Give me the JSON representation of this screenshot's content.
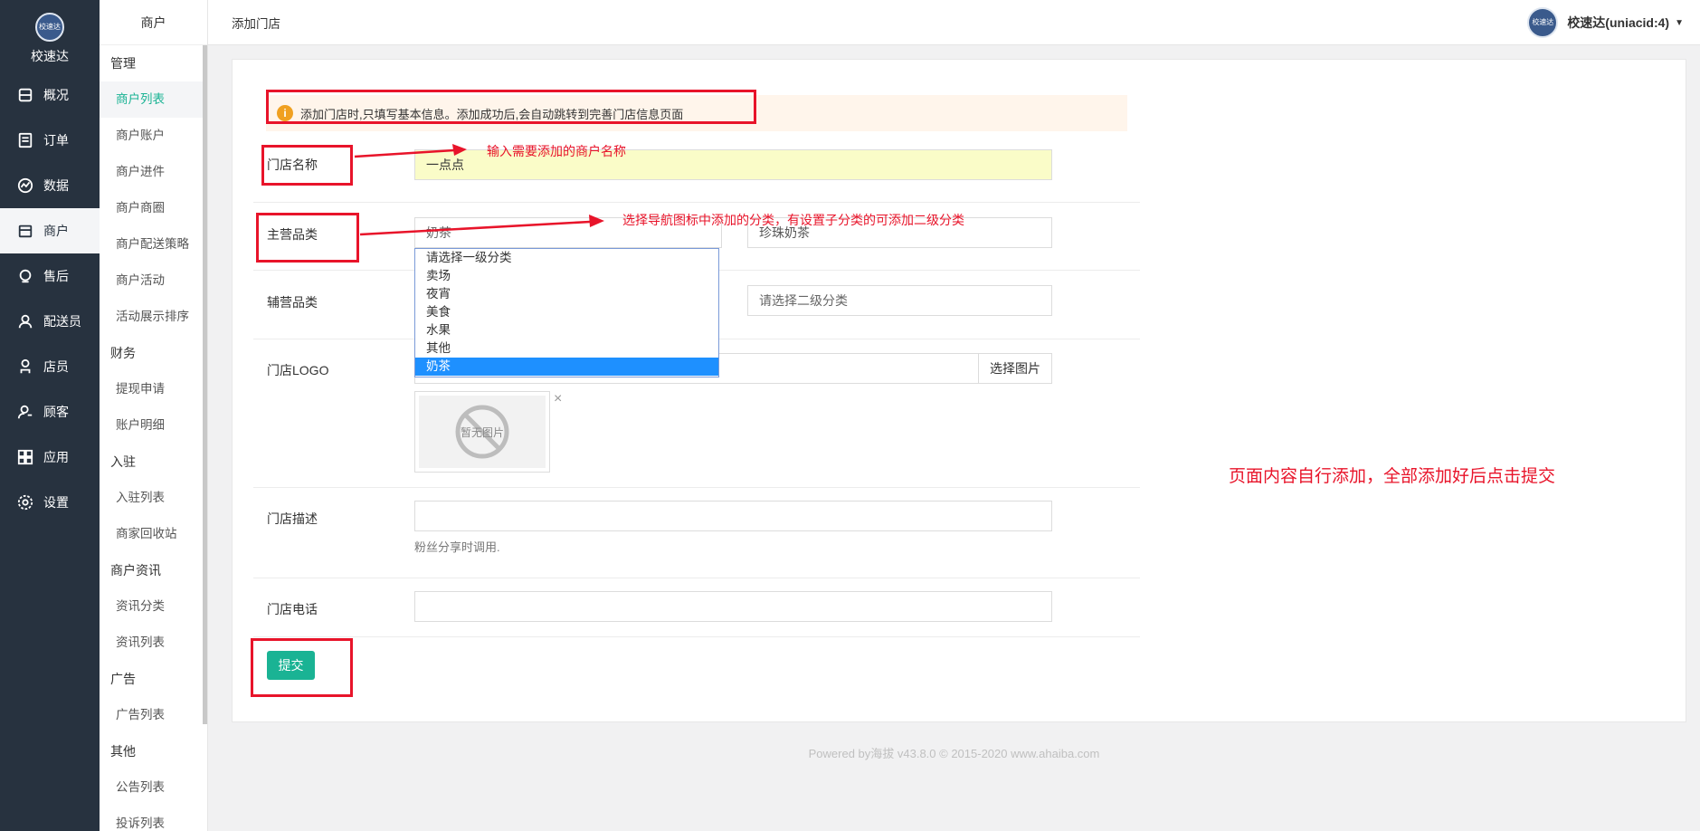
{
  "brand": {
    "logo_text": "校速达",
    "name": "校速达"
  },
  "nav": [
    {
      "label": "概况",
      "icon": "overview-icon"
    },
    {
      "label": "订单",
      "icon": "order-icon"
    },
    {
      "label": "数据",
      "icon": "data-icon"
    },
    {
      "label": "商户",
      "icon": "merchant-icon",
      "active": true
    },
    {
      "label": "售后",
      "icon": "aftersale-icon"
    },
    {
      "label": "配送员",
      "icon": "courier-icon"
    },
    {
      "label": "店员",
      "icon": "staff-icon"
    },
    {
      "label": "顾客",
      "icon": "customer-icon"
    },
    {
      "label": "应用",
      "icon": "apps-icon"
    },
    {
      "label": "设置",
      "icon": "settings-icon"
    }
  ],
  "submenu": {
    "title": "商户",
    "groups": [
      {
        "label": "管理",
        "items": [
          "商户列表",
          "商户账户",
          "商户进件",
          "商户商圈",
          "商户配送策略",
          "商户活动",
          "活动展示排序"
        ]
      },
      {
        "label": "财务",
        "items": [
          "提现申请",
          "账户明细"
        ]
      },
      {
        "label": "入驻",
        "items": [
          "入驻列表",
          "商家回收站"
        ]
      },
      {
        "label": "商户资讯",
        "items": [
          "资讯分类",
          "资讯列表"
        ]
      },
      {
        "label": "广告",
        "items": [
          "广告列表"
        ]
      },
      {
        "label": "其他",
        "items": [
          "公告列表",
          "投诉列表"
        ]
      }
    ],
    "active_item": "商户列表"
  },
  "topbar": {
    "page_title": "添加门店",
    "user_name": "校速达(uniacid:4)",
    "avatar_text": "校速达"
  },
  "alert": {
    "text": "添加门店时,只填写基本信息。添加成功后,会自动跳转到完善门店信息页面"
  },
  "form": {
    "store_name_label": "门店名称",
    "store_name_value": "一点点",
    "main_category_label": "主营品类",
    "main_category_value": "奶茶",
    "main_subcategory_value": "珍珠奶茶",
    "sub_category_label": "辅营品类",
    "sub_subcategory_placeholder": "请选择二级分类",
    "dropdown_options": [
      "请选择一级分类",
      "卖场",
      "夜宵",
      "美食",
      "水果",
      "其他",
      "奶茶"
    ],
    "dropdown_selected": "奶茶",
    "logo_label": "门店LOGO",
    "pick_image_label": "选择图片",
    "no_image_text": "暂无图片",
    "close_symbol": "×",
    "desc_label": "门店描述",
    "desc_hint": "粉丝分享时调用.",
    "phone_label": "门店电话",
    "submit_label": "提交"
  },
  "annotations": {
    "name_note": "输入需要添加的商户名称",
    "category_note": "选择导航图标中添加的分类，有设置子分类的可添加二级分类",
    "submit_note": "页面内容自行添加，全部添加好后点击提交",
    "color": "#e8142a"
  },
  "footer": {
    "text": "Powered by海拔 v43.8.0 © 2015-2020 www.ahaiba.com"
  },
  "colors": {
    "nav_bg": "#27323f",
    "accent": "#1ab394",
    "alert_bg": "#fff5eb",
    "select_highlight": "#1e90ff"
  }
}
